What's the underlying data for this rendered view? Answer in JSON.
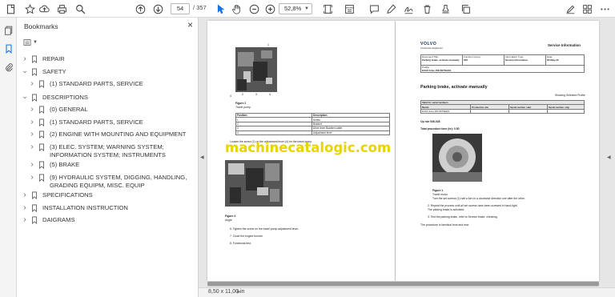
{
  "toolbar": {
    "page_current": "54",
    "page_total": "/ 357",
    "zoom": "52,8%"
  },
  "sidebar": {
    "title": "Bookmarks",
    "items": [
      {
        "label": "REPAIR",
        "indent": 0,
        "expanded": false
      },
      {
        "label": "SAFETY",
        "indent": 0,
        "expanded": true
      },
      {
        "label": "(1) STANDARD PARTS, SERVICE",
        "indent": 1,
        "expanded": false
      },
      {
        "label": "DESCRIPTIONS",
        "indent": 0,
        "expanded": true
      },
      {
        "label": "(0) GENERAL",
        "indent": 1,
        "expanded": false
      },
      {
        "label": "(1) STANDARD PARTS, SERVICE",
        "indent": 1,
        "expanded": false
      },
      {
        "label": "(2) ENGINE WITH MOUNTING AND EQUIPMENT",
        "indent": 1,
        "expanded": false
      },
      {
        "label": "(3) ELEC. SYSTEM; WARNING SYSTEM; INFORMATION SYSTEM; INSTRUMENTS",
        "indent": 1,
        "expanded": false
      },
      {
        "label": "(5) BRAKE",
        "indent": 1,
        "expanded": false
      },
      {
        "label": "(9) HYDRAULIC SYSTEM, DIGGING, HANDLING, GRADING EQUIPM, MISC. EQUIP",
        "indent": 1,
        "expanded": false
      },
      {
        "label": "SPECIFICATIONS",
        "indent": 0,
        "expanded": false
      },
      {
        "label": "INSTALLATION INSTRUCTION",
        "indent": 0,
        "expanded": false
      },
      {
        "label": "DAIGRAMS",
        "indent": 0,
        "expanded": false
      }
    ]
  },
  "page_left": {
    "fig_num": "4",
    "fig2_title": "Figure 2",
    "fig2_caption": "Travel pump",
    "table_headers": [
      "Position",
      "Description"
    ],
    "table_rows": [
      [
        "1",
        "Screw"
      ],
      [
        "2",
        "Bracket"
      ],
      [
        "3",
        "Drive lever Bowden cable"
      ],
      [
        "4",
        "Adjustment lever"
      ]
    ],
    "step_line": "Loosen the screw (1) on the adjustment lever (4) for the travel pump.",
    "fig3_title": "Figure 3",
    "fig3_caption": "Angle",
    "steps": [
      "6.   Tighten the screw on the travel pump adjustment lever.",
      "7.   Close the engine bonnet.",
      "8.   Functional test."
    ]
  },
  "page_right": {
    "brand": "VOLVO",
    "brand_sub": "Construction Equipment",
    "header_right": "Service Information",
    "meta_headers": [
      "Document Title:",
      "Function Group:",
      "Information Type:",
      "Date:"
    ],
    "meta_values": [
      "Parking brake, activate manually",
      "500",
      "Service Information",
      "05-May-22"
    ],
    "profile_label": "Profile:",
    "profile_value": "EX18 Volvo PID 8075E401",
    "title": "Parking brake, activate manually",
    "showing": "Showing Selected Profile",
    "serial_title": "Valid for serial numbers",
    "serial_headers": [
      "Model",
      "Production site",
      "Serial number start",
      "Serial number stop"
    ],
    "serial_row": [
      "EX18 Volvo PID 8075E401",
      "",
      "",
      ""
    ],
    "op_ref": "Op nbr 536-028",
    "total_time": "Total procedure time (hr):  0.50",
    "fig_title": "Figure 1",
    "fig_caption": "Travel motor",
    "fig_note": "Turn the set screws (1) half a turn in a clockwise direction one after the other.",
    "steps": [
      "2.   Repeat the process until all set screws have been screwed in hand-tight.",
      "      The parking brake is activated.",
      "3.   Test the parking brake, refer to Service brake, checking."
    ],
    "note_end": "The procedure is identical front and rear."
  },
  "status": {
    "page_size": "8,50 x 11,00 in"
  },
  "watermark": "machinecatalogic.com"
}
